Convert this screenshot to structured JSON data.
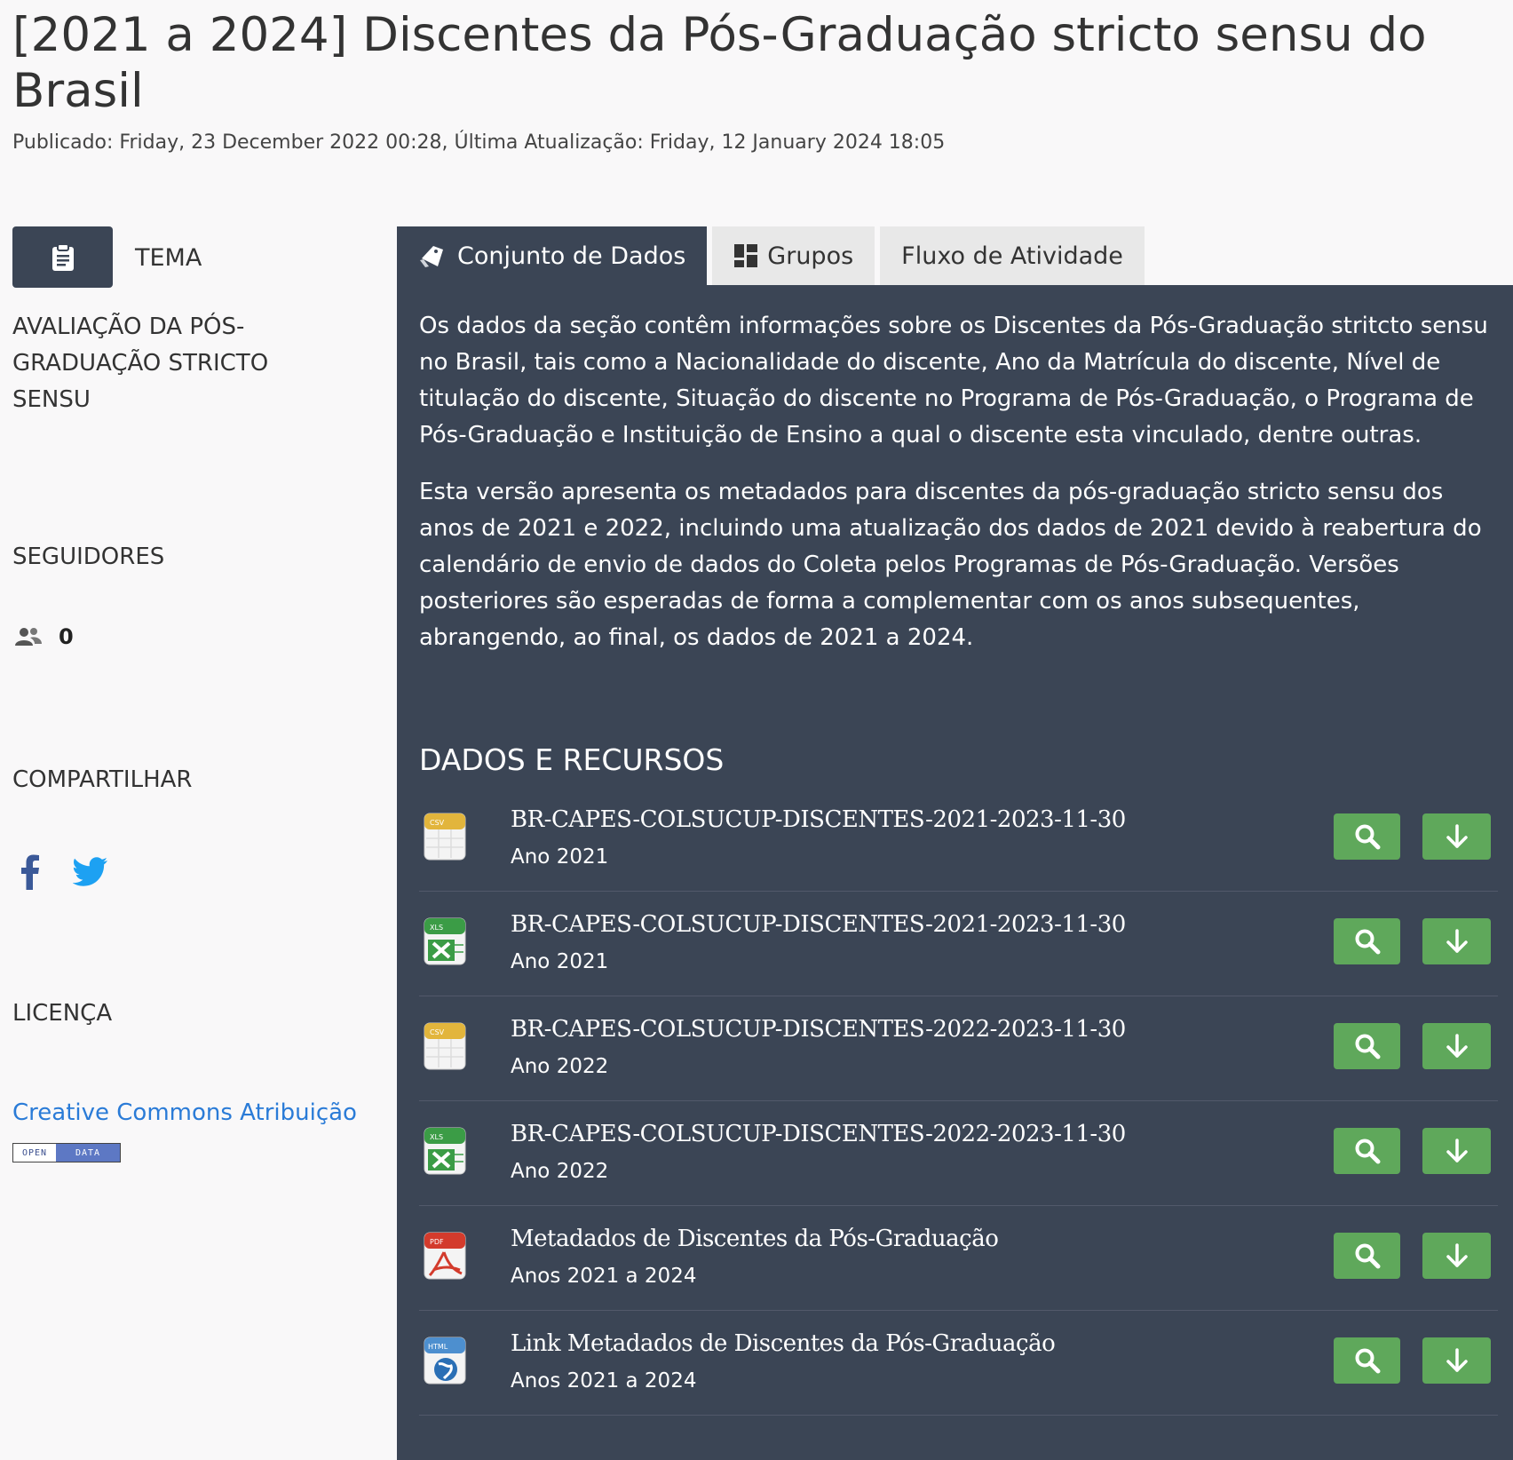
{
  "page": {
    "title": "[2021 a 2024] Discentes da Pós-Graduação stricto sensu do Brasil",
    "meta": "Publicado: Friday, 23 December 2022 00:28, Última Atualização: Friday, 12 January 2024 18:05"
  },
  "sidebar": {
    "tema_label": "TEMA",
    "tema_icon": "clipboard-icon",
    "theme_name": "AVALIAÇÃO DA PÓS-GRADUAÇÃO STRICTO SENSU",
    "followers_label": "SEGUIDORES",
    "followers_count": "0",
    "share_label": "COMPARTILHAR",
    "license_label": "LICENÇA",
    "license_link": "Creative Commons Atribuição",
    "opendata_badge": {
      "open": "OPEN",
      "data": "DATA"
    }
  },
  "tabs": [
    {
      "label": "Conjunto de Dados",
      "icon": "tag-icon",
      "active": true
    },
    {
      "label": "Grupos",
      "icon": "grid-icon",
      "active": false
    },
    {
      "label": "Fluxo de Atividade",
      "icon": "",
      "active": false
    }
  ],
  "description": [
    "Os dados da seção contêm informações sobre os Discentes da Pós-Graduação stritcto sensu no Brasil, tais como a Nacionalidade do discente, Ano da Matrícula do discente, Nível de titulação do discente, Situação do discente no Programa de Pós-Graduação, o Programa de Pós-Graduação e Instituição de Ensino a qual o discente esta vinculado, dentre outras.",
    "Esta versão apresenta os metadados para discentes da pós-graduação stricto sensu dos anos de 2021 e 2022, incluindo uma atualização dos dados de 2021 devido à reabertura do calendário de envio de dados do Coleta pelos Programas de Pós-Graduação. Versões posteriores são esperadas de forma a complementar com os anos subsequentes, abrangendo, ao final, os dados de 2021 a 2024."
  ],
  "resources": {
    "heading": "DADOS E RECURSOS",
    "items": [
      {
        "name": "BR-CAPES-COLSUCUP-DISCENTES-2021-2023-11-30",
        "sub": "Ano 2021",
        "format": "CSV"
      },
      {
        "name": "BR-CAPES-COLSUCUP-DISCENTES-2021-2023-11-30",
        "sub": "Ano 2021",
        "format": "XLS"
      },
      {
        "name": "BR-CAPES-COLSUCUP-DISCENTES-2022-2023-11-30",
        "sub": "Ano 2022",
        "format": "CSV"
      },
      {
        "name": "BR-CAPES-COLSUCUP-DISCENTES-2022-2023-11-30",
        "sub": "Ano 2022",
        "format": "XLS"
      },
      {
        "name": "Metadados de Discentes da Pós-Graduação",
        "sub": "Anos 2021 a 2024",
        "format": "PDF"
      },
      {
        "name": "Link Metadados de Discentes da Pós-Graduação",
        "sub": "Anos 2021 a 2024",
        "format": "HTML"
      }
    ]
  },
  "colors": {
    "panel": "#3b4555",
    "button_green": "#5fa85b",
    "link_blue": "#2a7bd7",
    "facebook": "#3b5998",
    "twitter": "#1da1f2"
  }
}
